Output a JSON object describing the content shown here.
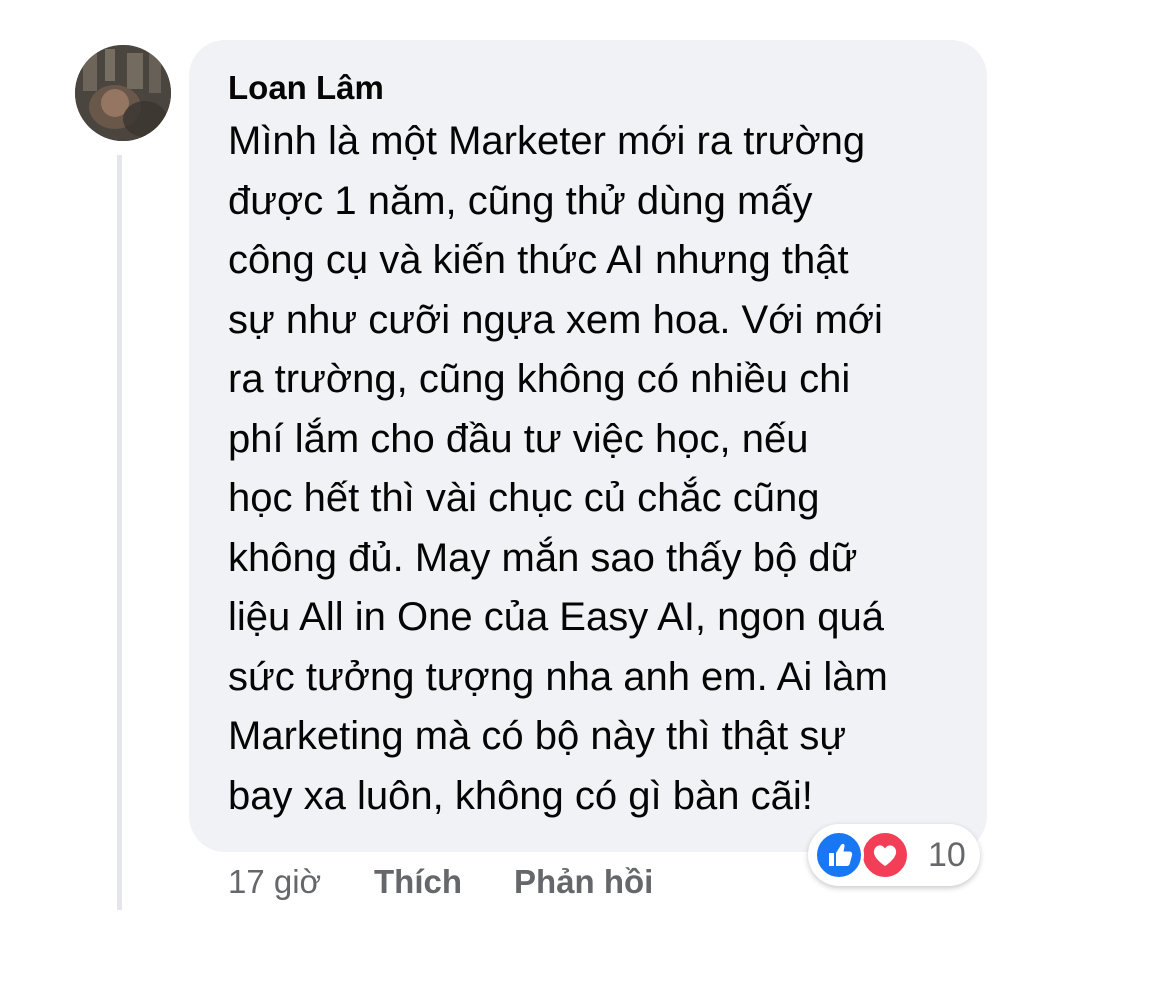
{
  "comment": {
    "author": "Loan Lâm",
    "text_lines": [
      "Mình là một Marketer mới ra trường",
      "được 1 năm, cũng thử dùng  mấy",
      "công cụ và kiến thức AI nhưng thật",
      "sự như cưỡi ngựa xem hoa. Với mới",
      "ra trường, cũng không có nhiều chi",
      "phí lắm cho đầu tư việc học, nếu",
      "học hết thì vài chục củ chắc cũng",
      "không đủ. May mắn sao thấy bộ dữ",
      "liệu All in One của Easy AI, ngon quá",
      "sức tưởng tượng nha anh em. Ai làm",
      "Marketing mà có bộ này thì thật sự",
      "bay xa luôn, không có gì bàn cãi!"
    ],
    "timestamp": "17 giờ",
    "like_label": "Thích",
    "reply_label": "Phản hồi",
    "reactions": {
      "icons": [
        "like-icon",
        "love-icon"
      ],
      "count": "10",
      "like_color": "#1877f2",
      "love_color": "#f33e58"
    }
  },
  "colors": {
    "bubble_bg": "#f0f2f5",
    "text": "#050505",
    "secondary_text": "#65676b",
    "thread_line": "#e4e6eb"
  }
}
